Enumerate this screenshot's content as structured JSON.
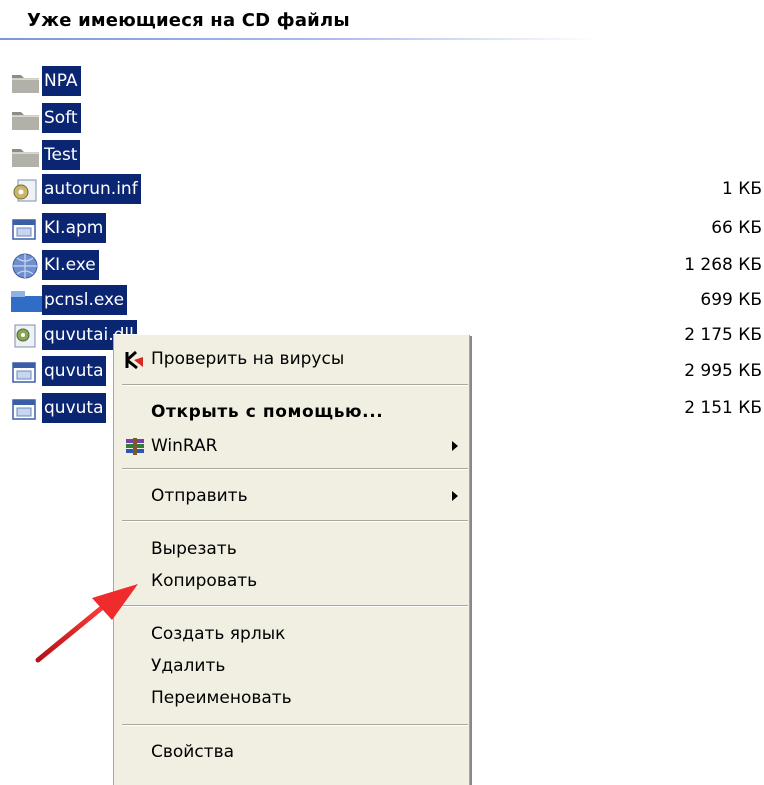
{
  "header": {
    "title": "Уже имеющиеся на CD файлы"
  },
  "files": [
    {
      "name": "NPA",
      "size": "",
      "icon": "folder-icon"
    },
    {
      "name": "Soft",
      "size": "",
      "icon": "folder-icon"
    },
    {
      "name": "Test",
      "size": "",
      "icon": "folder-icon"
    },
    {
      "name": "autorun.inf",
      "size": "1 КБ",
      "icon": "settings-file-icon"
    },
    {
      "name": "KI.apm",
      "size": "66 КБ",
      "icon": "application-file-icon"
    },
    {
      "name": "KI.exe",
      "size": "1 268 КБ",
      "icon": "globe-exe-icon"
    },
    {
      "name": "pcnsl.exe",
      "size": "699 КБ",
      "icon": "exe-file-icon"
    },
    {
      "name": "quvutai.dll",
      "size": "2 175 КБ",
      "icon": "dll-file-icon"
    },
    {
      "name": "quvuta",
      "size": "2 995 КБ",
      "icon": "application-file-icon"
    },
    {
      "name": "quvuta",
      "size": "2 151 КБ",
      "icon": "application-file-icon"
    }
  ],
  "context_menu": {
    "items": {
      "scan": "Проверить на вирусы",
      "open_with": "Открыть с помощью...",
      "winrar": "WinRAR",
      "send_to": "Отправить",
      "cut": "Вырезать",
      "copy": "Копировать",
      "create_shortcut": "Создать ярлык",
      "delete": "Удалить",
      "rename": "Переименовать",
      "properties": "Свойства"
    }
  },
  "colors": {
    "selection": "#0a2571",
    "menu_background": "#f1efe2",
    "annotation_arrow": "#e8232a"
  }
}
